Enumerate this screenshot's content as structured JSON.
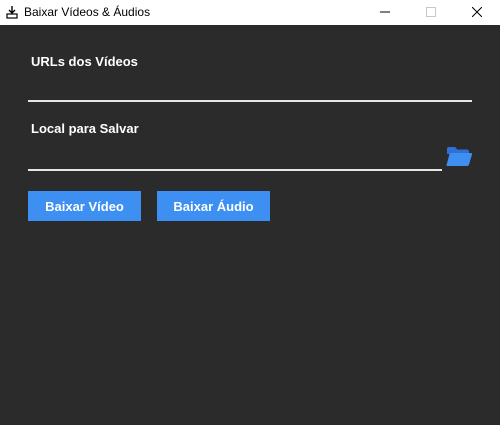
{
  "window": {
    "title": "Baixar Vídeos & Áudios",
    "icon": "download-app-icon",
    "controls": [
      "minimize-icon",
      "maximize-icon",
      "close-icon"
    ]
  },
  "form": {
    "urls_label": "URLs dos Vídeos",
    "urls_value": "",
    "save_label": "Local para Salvar",
    "save_value": "",
    "folder_icon": "folder-icon"
  },
  "actions": {
    "video_button": "Baixar Vídeo",
    "audio_button": "Baixar Áudio"
  },
  "colors": {
    "background": "#2b2b2b",
    "accent": "#3d8ff2",
    "titlebar": "#ffffff",
    "input_line": "#e6e6e6"
  }
}
